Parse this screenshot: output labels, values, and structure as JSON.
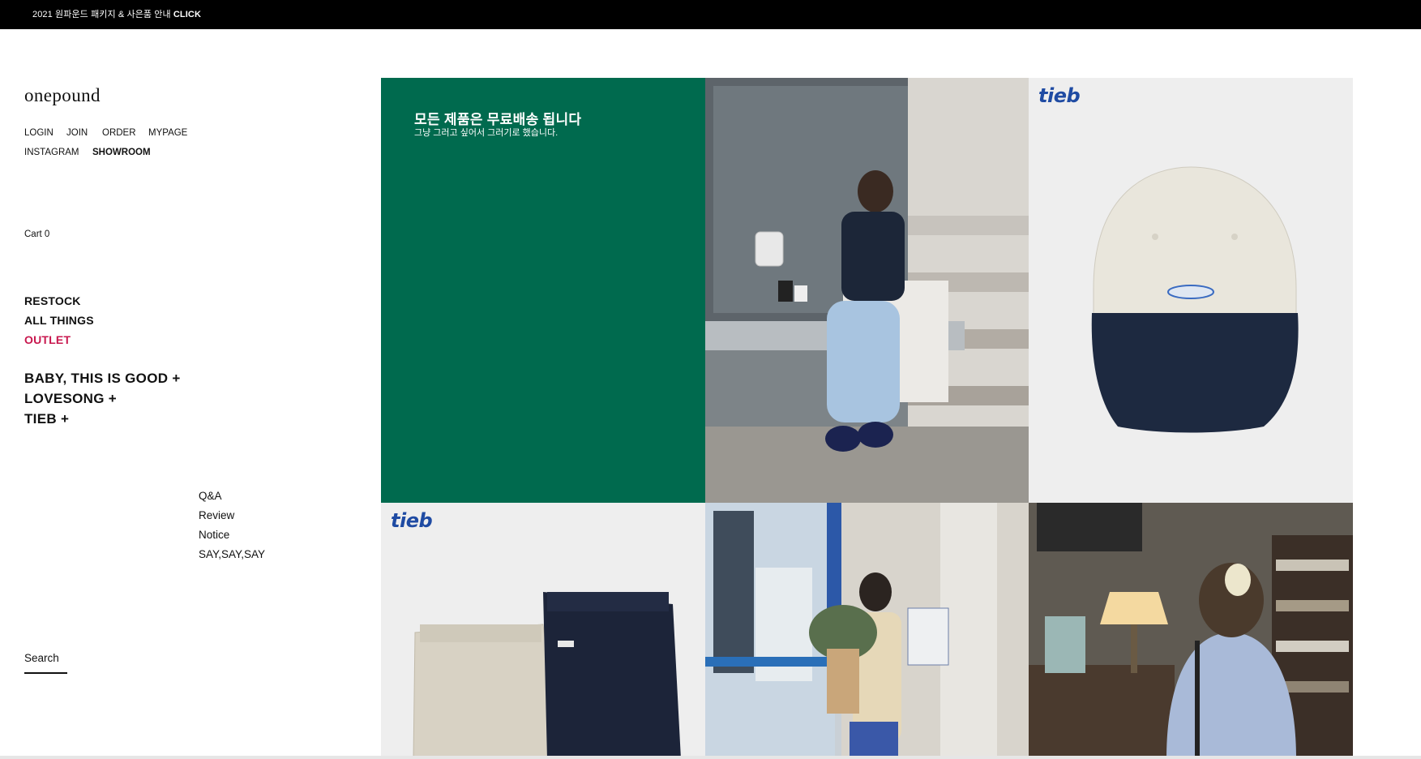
{
  "topbar": {
    "notice_prefix": "2021 원파운드 패키지 & 사은품 안내 ",
    "notice_link": "CLICK"
  },
  "logo": "onepound",
  "account_menu": {
    "login": "LOGIN",
    "join": "JOIN",
    "order": "ORDER",
    "mypage": "MYPAGE",
    "instagram": "INSTAGRAM",
    "showroom": "SHOWROOM"
  },
  "cart": "Cart 0",
  "categories": {
    "restock": "RESTOCK",
    "all_things": "ALL THINGS",
    "outlet": "OUTLET",
    "baby": "BABY, THIS IS GOOD +",
    "lovesong": "LOVESONG +",
    "tieb": "TIEB +"
  },
  "board": {
    "qa": "Q&A",
    "review": "Review",
    "notice": "Notice",
    "saysay": "SAY,SAY,SAY"
  },
  "search_label": "Search",
  "promo": {
    "title": "모든 제품은 무료배송 됩니다",
    "subtitle": "그냥 그러고 싶어서 그러기로 했습니다."
  },
  "tiles": {
    "brand_cap": "tieb",
    "brand_pants": "tieb"
  },
  "colors": {
    "promo_bg": "#006a4e",
    "outlet": "#c8174e",
    "brand_blue": "#1f4ba3"
  }
}
